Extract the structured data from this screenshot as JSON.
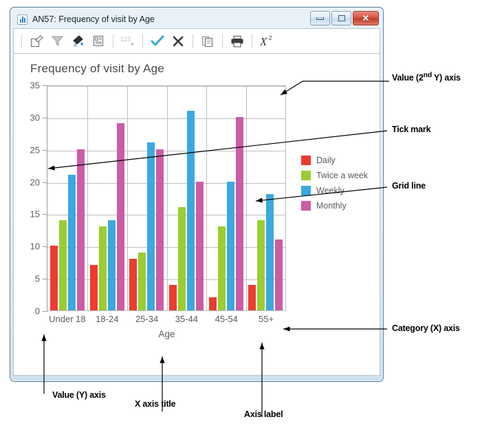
{
  "window": {
    "title": "AN57: Frequency of visit by Age",
    "icon": "bar-chart-icon",
    "controls": {
      "minimize": "minimize",
      "maximize": "maximize",
      "close": "close"
    }
  },
  "toolbar": {
    "items": [
      {
        "name": "edit-icon",
        "glyph": "edit",
        "enabled": true
      },
      {
        "name": "filter-icon",
        "glyph": "filter",
        "enabled": true
      },
      {
        "name": "fill-color-icon",
        "glyph": "fill",
        "enabled": true
      },
      {
        "name": "report-icon",
        "glyph": "report",
        "enabled": true
      },
      {
        "name": "number-format-icon",
        "glyph": "123",
        "enabled": false
      },
      {
        "name": "confirm-check-icon",
        "glyph": "check",
        "enabled": true
      },
      {
        "name": "cancel-x-icon",
        "glyph": "x",
        "enabled": true
      },
      {
        "name": "copy-icon",
        "glyph": "copy",
        "enabled": true
      },
      {
        "name": "print-icon",
        "glyph": "print",
        "enabled": true
      },
      {
        "name": "chi-square-icon",
        "glyph": "chi2",
        "enabled": true
      }
    ]
  },
  "chart_data": {
    "type": "bar",
    "title": "Frequency of visit by Age",
    "xlabel": "Age",
    "ylabel": "",
    "ylim": [
      0,
      35
    ],
    "yticks": [
      0,
      5,
      10,
      15,
      20,
      25,
      30,
      35
    ],
    "grid": true,
    "legend_position": "right",
    "categories": [
      "Under 18",
      "18-24",
      "25-34",
      "35-44",
      "45-54",
      "55+"
    ],
    "series": [
      {
        "name": "Daily",
        "color": "#EE3B2F",
        "values": [
          10,
          7,
          8,
          4,
          2,
          4
        ]
      },
      {
        "name": "Twice a week",
        "color": "#9ACD32",
        "values": [
          14,
          13,
          9,
          16,
          13,
          14
        ]
      },
      {
        "name": "Weekly",
        "color": "#3BA8E0",
        "values": [
          21,
          14,
          26,
          31,
          20,
          18
        ]
      },
      {
        "name": "Monthly",
        "color": "#CC5BA8",
        "values": [
          25,
          29,
          25,
          20,
          30,
          11
        ]
      }
    ]
  },
  "annotations": [
    {
      "id": "value-2nd-y-axis",
      "label_html": "Value (2<sup>nd</sup> Y) axis",
      "label": "Value (2nd Y) axis"
    },
    {
      "id": "tick-mark",
      "label": "Tick mark"
    },
    {
      "id": "grid-line",
      "label": "Grid line"
    },
    {
      "id": "category-x-axis",
      "label": "Category (X) axis"
    },
    {
      "id": "value-y-axis",
      "label": "Value (Y) axis"
    },
    {
      "id": "x-axis-title",
      "label": "X axis title"
    },
    {
      "id": "axis-label",
      "label": "Axis label"
    }
  ],
  "colors": {
    "daily": "#EE3B2F",
    "twice_a_week": "#9ACD32",
    "weekly": "#3BA8E0",
    "monthly": "#CC5BA8",
    "grid": "#BFBFBF",
    "axis_text": "#5A5C5E",
    "title_text": "#46484A",
    "window_border": "#4F7C9C"
  }
}
